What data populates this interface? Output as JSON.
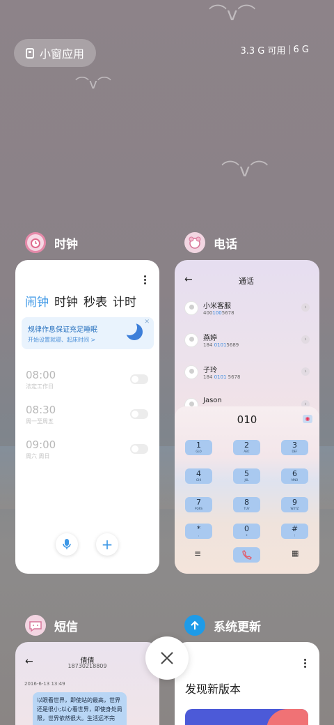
{
  "top_bar": {
    "small_apps_label": "小窗应用",
    "memory_available": "3.3 G 可用",
    "memory_total": "6 G"
  },
  "apps": {
    "clock": {
      "name": "时钟",
      "tabs": [
        "闹钟",
        "时钟",
        "秒表",
        "计时"
      ],
      "banner_title": "规律作息保证充足睡眠",
      "banner_sub": "开始设置就寝、起床时间 >",
      "alarms": [
        {
          "time": "08:00",
          "sub": "法定工作日"
        },
        {
          "time": "08:30",
          "sub": "周一至周五"
        },
        {
          "time": "09:00",
          "sub": "周六 周日"
        }
      ]
    },
    "phone": {
      "name": "电话",
      "header": "通话",
      "contacts": [
        {
          "name": "小米客服",
          "num_a": "400",
          "num_b": "100",
          "num_c": "5678"
        },
        {
          "name": "燕婷",
          "num_a": "184 ",
          "num_b": "0101",
          "num_c": "5689"
        },
        {
          "name": "子玲",
          "num_a": "184 ",
          "num_b": "0101",
          "num_c": " 5678"
        },
        {
          "name": "Jason",
          "num_a": "",
          "num_b": "",
          "num_c": ""
        }
      ],
      "dialed": "010",
      "keys": [
        {
          "d": "1",
          "l": "GLO"
        },
        {
          "d": "2",
          "l": "ABC"
        },
        {
          "d": "3",
          "l": "DEF"
        },
        {
          "d": "4",
          "l": "GHI"
        },
        {
          "d": "5",
          "l": "JKL"
        },
        {
          "d": "6",
          "l": "MNO"
        },
        {
          "d": "7",
          "l": "PQRS"
        },
        {
          "d": "8",
          "l": "TUV"
        },
        {
          "d": "9",
          "l": "WXYZ"
        },
        {
          "d": "*",
          "l": ","
        },
        {
          "d": "0",
          "l": "+"
        },
        {
          "d": "#",
          "l": ";"
        }
      ]
    },
    "sms": {
      "name": "短信",
      "contact_name": "倩倩",
      "contact_phone": "18730218809",
      "date": "2016-6-13 13:49",
      "message": "以眼看世界，即使站的最高，世界还是很小;以心看世界，即使身处局限，世界依然很大。生活远不完"
    },
    "update": {
      "name": "系统更新",
      "title": "发现新版本"
    }
  },
  "colors": {
    "accent": "#3c97e6",
    "update_icon": "#1e9be8"
  }
}
